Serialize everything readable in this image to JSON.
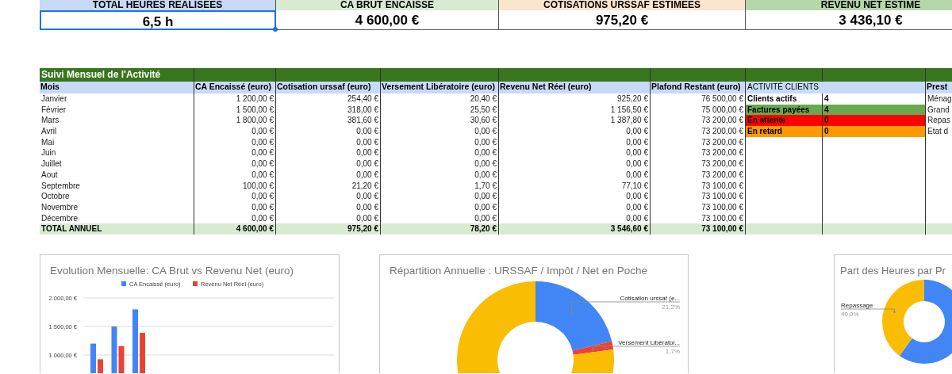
{
  "summary": [
    {
      "label": "TOTAL HEURES REALISEES",
      "value": "6,5 h",
      "color": "#c9daf8",
      "selected": true
    },
    {
      "label": "CA BRUT ENCAISSE",
      "value": "4 600,00 €",
      "color": "#d9ead3",
      "selected": false
    },
    {
      "label": "COTISATIONS URSSAF ESTIMEES",
      "value": "975,20 €",
      "color": "#fce5cd",
      "selected": false
    },
    {
      "label": "REVENU NET ESTIME",
      "value": "3 436,10 €",
      "color": "#b6d7a8",
      "selected": false
    }
  ],
  "table": {
    "title": "Suivi Mensuel de l'Activité",
    "columns": [
      "Mois",
      "CA Encaissé (euro)",
      "Cotisation urssaf (euro)",
      "Versement Libératoire (euro)",
      "Revenu Net Réel (euro)",
      "Plafond Restant (euro)"
    ],
    "rows": [
      [
        "Janvier",
        "1 200,00 €",
        "254,40 €",
        "20,40 €",
        "925,20 €",
        "76 500,00 €"
      ],
      [
        "Février",
        "1 500,00 €",
        "318,00 €",
        "25,50 €",
        "1 156,50 €",
        "75 000,00 €"
      ],
      [
        "Mars",
        "1 800,00 €",
        "381,60 €",
        "30,60 €",
        "1 387,80 €",
        "73 200,00 €"
      ],
      [
        "Avril",
        "0,00 €",
        "0,00 €",
        "0,00 €",
        "0,00 €",
        "73 200,00 €"
      ],
      [
        "Mai",
        "0,00 €",
        "0,00 €",
        "0,00 €",
        "0,00 €",
        "73 200,00 €"
      ],
      [
        "Juin",
        "0,00 €",
        "0,00 €",
        "0,00 €",
        "0,00 €",
        "73 200,00 €"
      ],
      [
        "Juillet",
        "0,00 €",
        "0,00 €",
        "0,00 €",
        "0,00 €",
        "73 200,00 €"
      ],
      [
        "Aout",
        "0,00 €",
        "0,00 €",
        "0,00 €",
        "0,00 €",
        "73 200,00 €"
      ],
      [
        "Septembre",
        "100,00 €",
        "21,20 €",
        "1,70 €",
        "77,10 €",
        "73 100,00 €"
      ],
      [
        "Octobre",
        "0,00 €",
        "0,00 €",
        "0,00 €",
        "0,00 €",
        "73 100,00 €"
      ],
      [
        "Novembre",
        "0,00 €",
        "0,00 €",
        "0,00 €",
        "0,00 €",
        "73 100,00 €"
      ],
      [
        "Décembre",
        "0,00 €",
        "0,00 €",
        "0,00 €",
        "0,00 €",
        "73 100,00 €"
      ]
    ],
    "total": [
      "TOTAL ANNUEL",
      "4 600,00 €",
      "975,20 €",
      "78,20 €",
      "3 546,60 €",
      "73 100,00 €"
    ]
  },
  "clients": {
    "title": "ACTIVITÉ CLIENTS",
    "rows": [
      {
        "label": "Clients actifs",
        "value": "4",
        "color": "#ffffff"
      },
      {
        "label": "Factures payées",
        "value": "4",
        "color": "#6aa84f"
      },
      {
        "label": "En attente",
        "value": "0",
        "color": "#ff0000"
      },
      {
        "label": "En retard",
        "value": "0",
        "color": "#ff9900"
      }
    ]
  },
  "cut_column": {
    "header": "Prest",
    "cells": [
      "Ménag",
      "Grand",
      "Repas",
      "Etat d"
    ]
  },
  "charts": [
    {
      "chart_data": {
        "type": "bar",
        "title": "Evolution Mensuelle: CA Brut vs Revenu Net (euro)",
        "series": [
          {
            "name": "CA Encaissé (euro)",
            "color": "#4285f4",
            "values": [
              1200,
              1500,
              1800
            ]
          },
          {
            "name": "Revenu Net Réel (euro)",
            "color": "#ea4335",
            "values": [
              925,
              1157,
              1388
            ]
          }
        ],
        "legend": "top",
        "ylim": [
          0,
          2000
        ],
        "yticks": [
          {
            "value": 2000,
            "label": "2 000,00 €"
          },
          {
            "value": 1500,
            "label": "1 500,00 €"
          },
          {
            "value": 1000,
            "label": "1 000,00 €"
          }
        ]
      }
    },
    {
      "slices": [
        {
          "color": "#4285f4"
        },
        {
          "color": "#ea4335"
        },
        {
          "color": "#fbbc04"
        }
      ],
      "chart_data": {
        "type": "donut",
        "title": "Répartition Annuelle : URSSAF / Impôt / Net en Poche",
        "categories": [
          "Cotisation urssaf (e...",
          "Versement Libératoi...",
          null
        ],
        "values": [
          21.2,
          1.7,
          77.1
        ],
        "value_labels": [
          "21,2%",
          "1,7%",
          null
        ]
      }
    },
    {
      "slices": [
        {
          "color": "#4285f4"
        },
        {
          "color": "#fbbc04"
        }
      ],
      "chart_data": {
        "type": "donut",
        "title": "Part des Heures par Pr",
        "categories": [
          null,
          "Repassage"
        ],
        "values": [
          60,
          40
        ],
        "value_labels": [
          null,
          "40,0%"
        ]
      }
    }
  ]
}
